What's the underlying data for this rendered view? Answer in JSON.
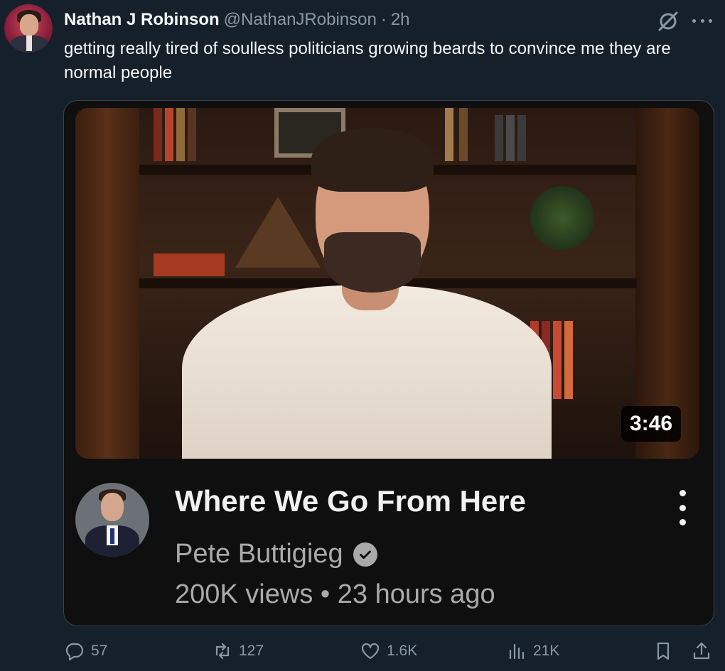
{
  "tweet": {
    "author_name": "Nathan J Robinson",
    "handle": "@NathanJRobinson",
    "separator": "·",
    "time": "2h",
    "text": "getting really tired of soulless politicians growing beards to convince me they are normal people"
  },
  "card": {
    "duration": "3:46",
    "video_title": "Where We Go From Here",
    "channel_name": "Pete Buttigieg",
    "meta": "200K views • 23 hours ago"
  },
  "actions": {
    "replies": "57",
    "reposts": "127",
    "likes": "1.6K",
    "views": "21K"
  },
  "icons": {
    "grok": "grok-icon",
    "more": "more-icon",
    "reply": "reply-icon",
    "repost": "repost-icon",
    "like": "heart-icon",
    "views": "analytics-icon",
    "bookmark": "bookmark-icon",
    "share": "share-icon",
    "verified": "verified-check-icon",
    "kebab": "kebab-menu-icon"
  },
  "colors": {
    "background": "#15202b",
    "secondary_text": "#8b98a5",
    "card_background": "#0f0f0f",
    "border": "#38444d"
  }
}
